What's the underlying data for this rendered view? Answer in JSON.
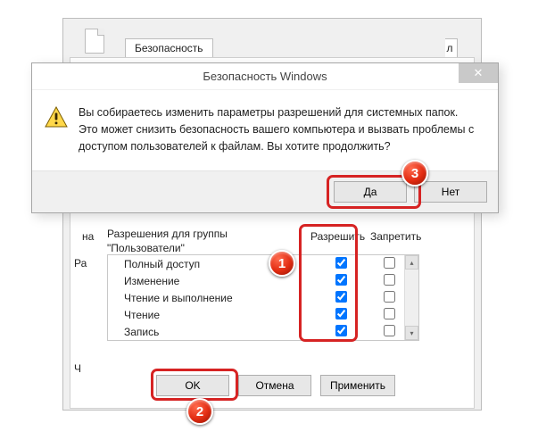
{
  "tabs": {
    "security": "Безопасность",
    "stub": "л"
  },
  "background": {
    "cut_na": "на",
    "cut_ra": "Ра",
    "cut_ch": "Ч",
    "group_label_line1": "Разрешения для группы",
    "group_label_line2": "\"Пользователи\"",
    "col_allow": "Разрешить",
    "col_deny": "Запретить",
    "permissions": [
      {
        "name": "Полный доступ",
        "allow": true,
        "deny": false
      },
      {
        "name": "Изменение",
        "allow": true,
        "deny": false
      },
      {
        "name": "Чтение и выполнение",
        "allow": true,
        "deny": false
      },
      {
        "name": "Чтение",
        "allow": true,
        "deny": false
      },
      {
        "name": "Запись",
        "allow": true,
        "deny": false
      }
    ],
    "buttons": {
      "ok": "OK",
      "cancel": "Отмена",
      "apply": "Применить"
    }
  },
  "modal": {
    "title": "Безопасность Windows",
    "close": "✕",
    "message": "Вы собираетесь изменить параметры разрешений для системных папок. Это может снизить безопасность вашего компьютера и вызвать проблемы с доступом пользователей к файлам. Вы хотите продолжить?",
    "yes": "Да",
    "no": "Нет"
  },
  "badges": {
    "b1": "1",
    "b2": "2",
    "b3": "3"
  }
}
